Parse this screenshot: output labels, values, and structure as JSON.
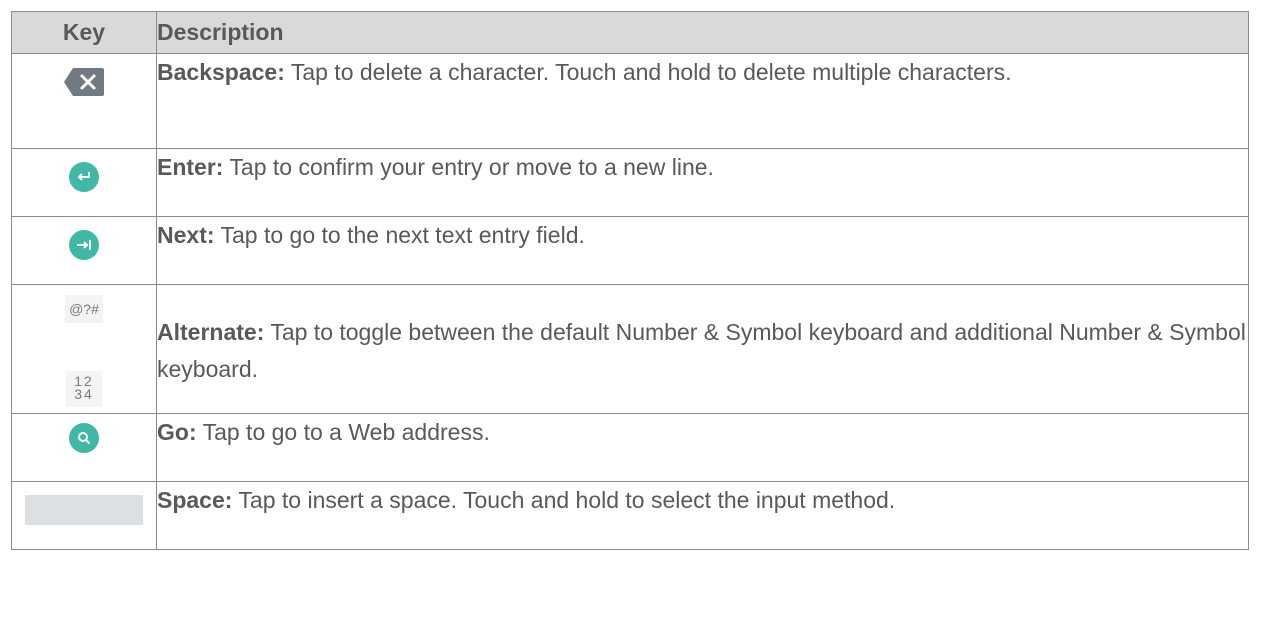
{
  "table": {
    "headers": {
      "key": "Key",
      "description": "Description"
    },
    "rows": [
      {
        "icon": "backspace-icon",
        "term": "Backspace:",
        "text": " Tap to delete a character. Touch and hold to delete multiple characters."
      },
      {
        "icon": "enter-icon",
        "term": "Enter:",
        "text": " Tap to confirm your entry or move to a new line."
      },
      {
        "icon": "next-icon",
        "term": "Next:",
        "text": " Tap to go to the next text entry field."
      },
      {
        "icon": "alternate-keys-icon",
        "key_symbol": "@?#",
        "key_number_top": "12",
        "key_number_bottom": "34",
        "term": "Alternate:",
        "text": " Tap to toggle between the default Number & Symbol keyboard and additional Number & Symbol keyboard."
      },
      {
        "icon": "search-icon",
        "term": "Go:",
        "text": " Tap to go to a Web address."
      },
      {
        "icon": "space-bar-icon",
        "term": "Space:",
        "text": " Tap to insert a space. Touch and hold to select the input method."
      }
    ]
  },
  "colors": {
    "accent": "#3fb8a5",
    "header_bg": "#d9d9d9",
    "text": "#595959",
    "backspace": "#707a80"
  }
}
